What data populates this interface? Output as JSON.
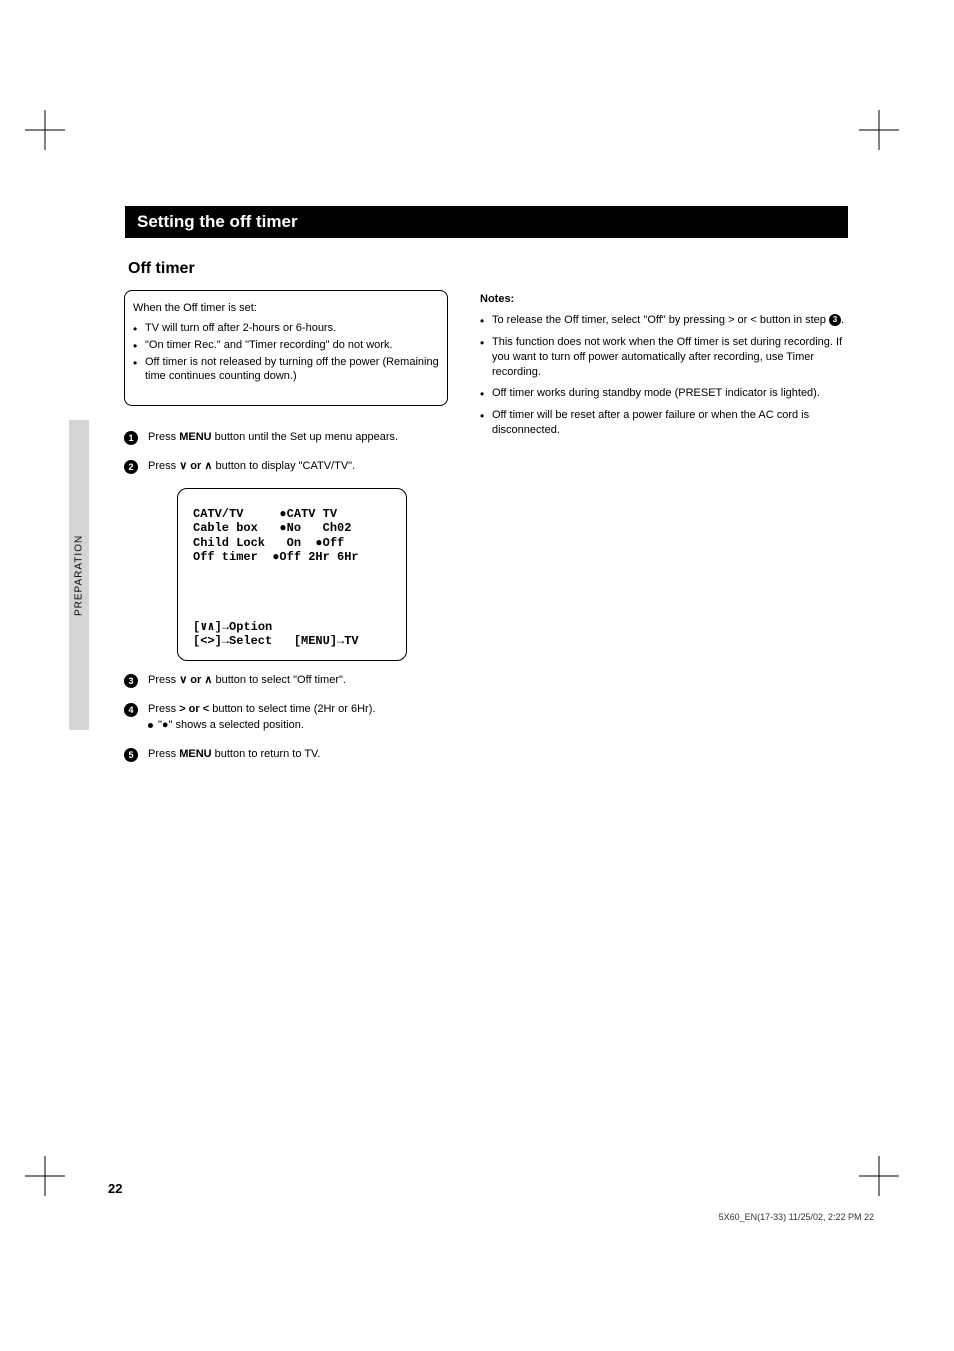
{
  "title_bar": "Setting the off timer",
  "section_title": "Off timer",
  "info_box": {
    "title": "When the Off timer is set:",
    "items": [
      "TV will turn off after 2-hours or 6-hours.",
      "\"On timer Rec.\" and \"Timer recording\" do not work.",
      "Off timer is not released by turning off the power (Remaining time continues counting down.)"
    ]
  },
  "side_tab": "PREPARATION",
  "steps": {
    "s1": {
      "num": "1",
      "text_before": "Press ",
      "bold": "MENU",
      "text_after": " button until the Set up menu appears."
    },
    "s2": {
      "num": "2",
      "text_before": "Press ",
      "chev": "∨ or ∧",
      "text_after": " button to display \"CATV/TV\"."
    },
    "screen": {
      "line1": "CATV/TV     ●CATV TV",
      "line2": "Cable box   ●No   Ch02",
      "line3": "Child Lock   On  ●Off",
      "line4": "Off timer  ●Off 2Hr 6Hr",
      "help1": "[∨∧]→Option",
      "help2": "[<>]→Select   [MENU]→TV"
    },
    "s3": {
      "num": "3",
      "text_before": "Press ",
      "chev": "∨ or ∧",
      "text_after": " button to select \"Off timer\"."
    },
    "s4": {
      "num": "4",
      "text_before": "Press ",
      "chev": "> or <",
      "text_after": " button to select time (2Hr or 6Hr).",
      "sub": "\"●\" shows a selected position."
    },
    "s5": {
      "num": "5",
      "text_before": "Press ",
      "bold": "MENU",
      "text_after": " button to return to TV."
    }
  },
  "right": {
    "title": "Notes:",
    "items": [
      {
        "pre": "To release the Off timer, select \"Off\" by pressing > or < button in step ",
        "num": "3",
        "post": "."
      },
      {
        "text": "This function does not work when the Off timer is set during recording. If you want to turn off power automatically after recording, use Timer recording."
      },
      {
        "text": "Off timer works during standby mode (PRESET indicator is lighted)."
      },
      {
        "text": "Off timer will be reset after a power failure or when the AC cord is disconnected."
      }
    ]
  },
  "footer_left": "22",
  "footer_right": "5X60_EN(17-33)    11/25/02, 2:22 PM    22"
}
